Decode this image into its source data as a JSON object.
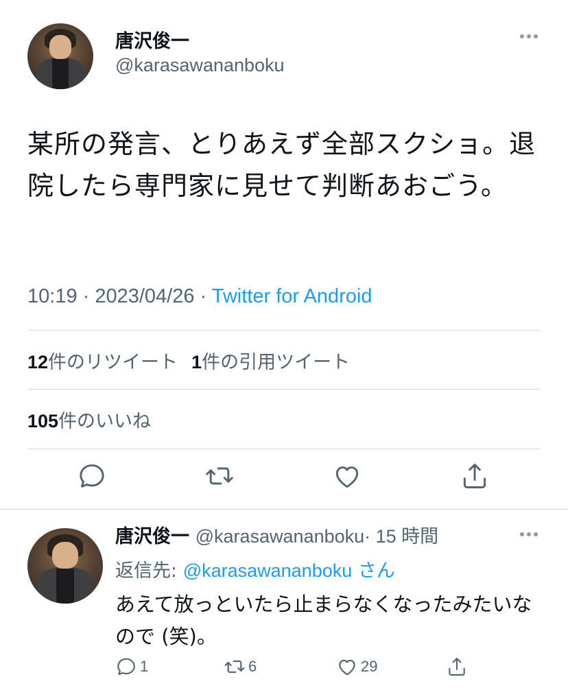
{
  "tweet": {
    "author_name": "唐沢俊一",
    "author_handle": "@karasawananboku",
    "text": "某所の発言、とりあえず全部スクショ。退院したら専門家に見せて判断あおごう。",
    "time": "10:19 · 2023/04/26 · ",
    "source": "Twitter for Android",
    "more_icon": "more-horizontal-icon"
  },
  "stats": {
    "retweets_count": "12",
    "retweets_label": "件のリツイート",
    "quotes_count": "1",
    "quotes_label": "件の引用ツイート",
    "likes_count": "105",
    "likes_label": "件のいいね"
  },
  "actions": {
    "reply_icon": "reply-icon",
    "retweet_icon": "retweet-icon",
    "like_icon": "like-icon",
    "share_icon": "share-icon"
  },
  "reply": {
    "author_name": "唐沢俊一",
    "author_handle": "@karasawananboku",
    "time": "· 15 時間",
    "reply_to_prefix": "返信先: ",
    "reply_to_handle": "@karasawananboku",
    "reply_to_suffix": " さん",
    "text": "あえて放っといたら止まらなくなったみたいなので (笑)。",
    "reply_count": "1",
    "retweet_count": "6",
    "like_count": "29"
  },
  "colors": {
    "accent": "#1d9bf0",
    "secondary_text": "#536471",
    "divider": "#cfd9de"
  }
}
